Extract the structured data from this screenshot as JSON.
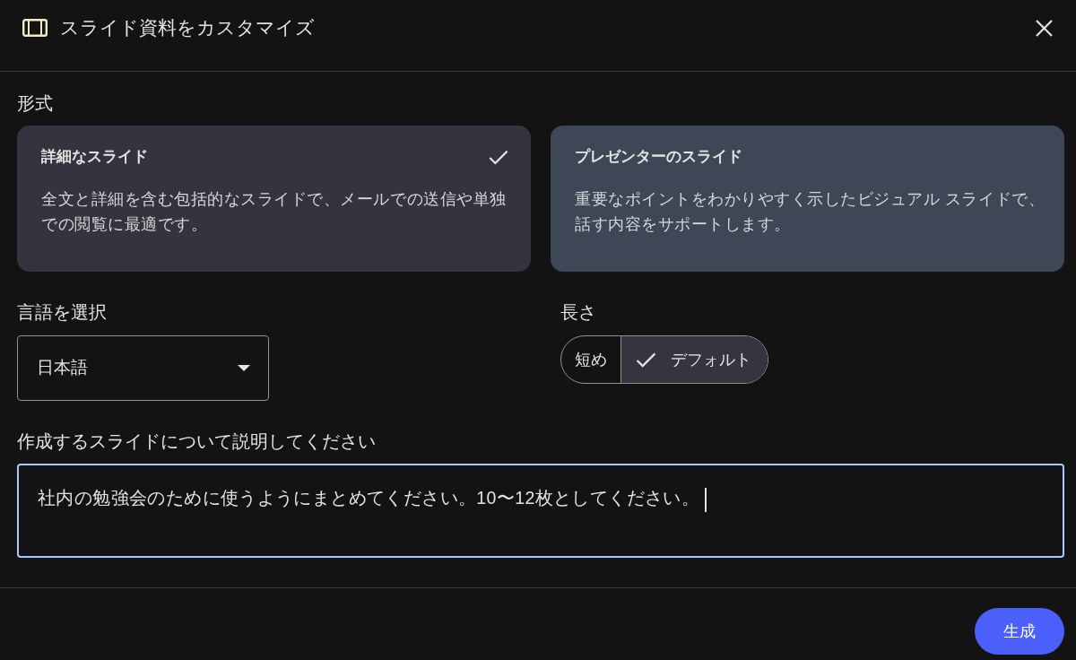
{
  "dialog": {
    "title": "スライド資料をカスタマイズ"
  },
  "format": {
    "label": "形式",
    "options": [
      {
        "title": "詳細なスライド",
        "description": "全文と詳細を含む包括的なスライドで、メールでの送信や単独での閲覧に最適です。",
        "selected": true
      },
      {
        "title": "プレゼンターのスライド",
        "description": "重要なポイントをわかりやすく示したビジュアル スライドで、話す内容をサポートします。",
        "selected": false
      }
    ]
  },
  "language": {
    "label": "言語を選択",
    "value": "日本語"
  },
  "length": {
    "label": "長さ",
    "options": [
      {
        "label": "短め",
        "selected": false
      },
      {
        "label": "デフォルト",
        "selected": true
      }
    ]
  },
  "description": {
    "label": "作成するスライドについて説明してください",
    "value": "社内の勉強会のために使うようにまとめてください。10〜12枚としてください。",
    "focused": true
  },
  "buttons": [
    {
      "label": "生成"
    }
  ]
}
